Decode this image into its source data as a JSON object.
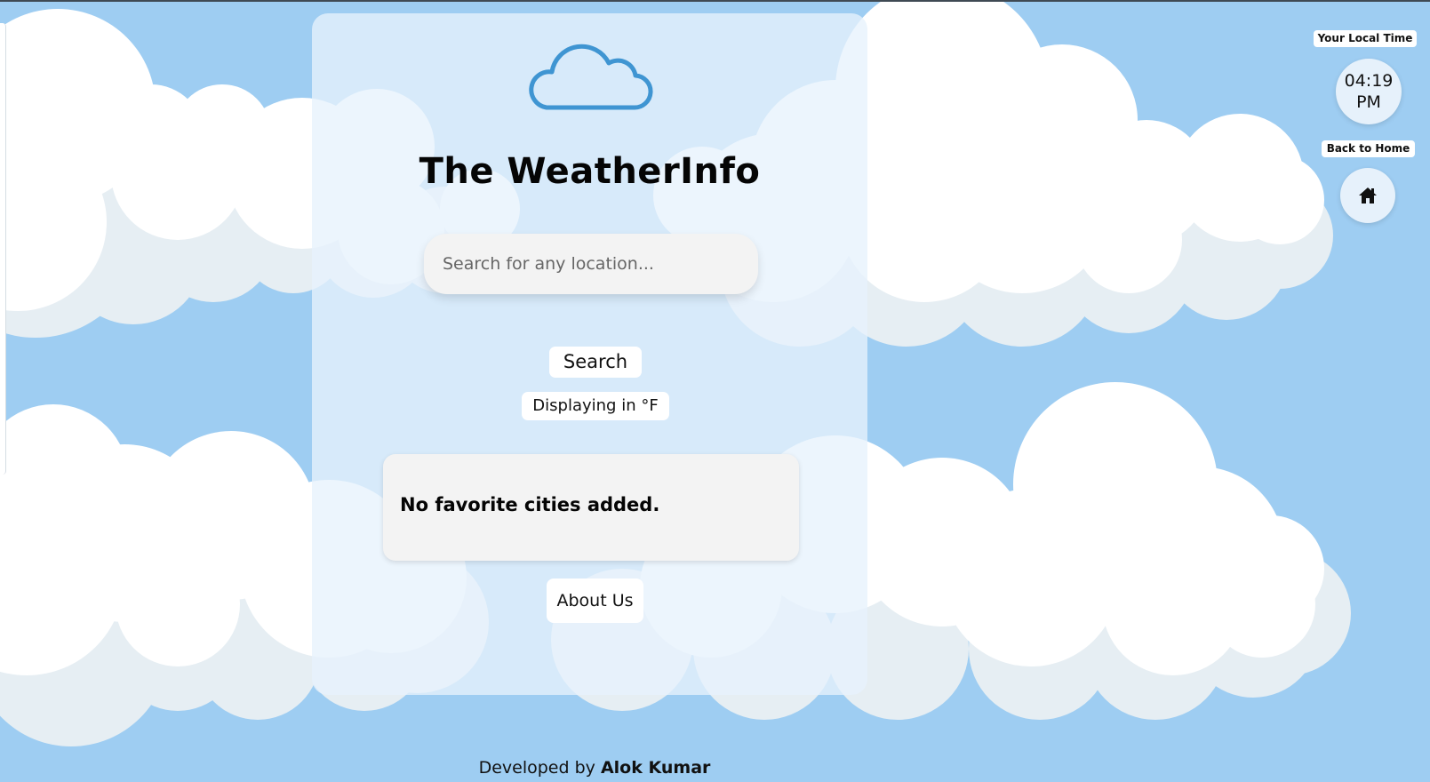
{
  "header": {
    "app_title": "The WeatherInfo"
  },
  "search": {
    "placeholder": "Search for any location...",
    "button_label": "Search"
  },
  "units": {
    "toggle_label": "Displaying in °F"
  },
  "favorites": {
    "empty_message": "No favorite cities added."
  },
  "about": {
    "button_label": "About Us"
  },
  "footer": {
    "prefix": "Developed by ",
    "author": "Alok Kumar"
  },
  "clock": {
    "label": "Your Local Time",
    "time": "04:19",
    "period": "PM"
  },
  "home": {
    "label": "Back to Home"
  },
  "icons": {
    "logo": "cloud-icon",
    "home": "home-icon"
  },
  "colors": {
    "sky": "#9ecdf2",
    "card": "#e7f2fc",
    "logo_stroke": "#3f95d2"
  }
}
